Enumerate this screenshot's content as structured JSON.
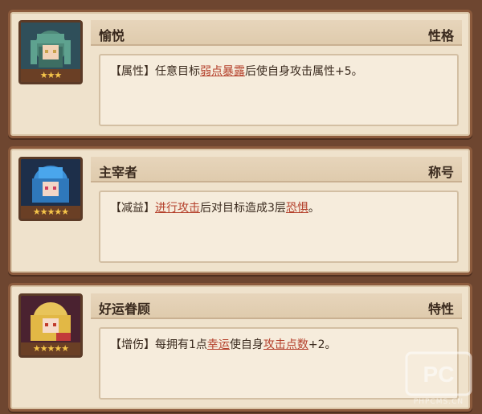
{
  "cards": [
    {
      "name": "愉悦",
      "tag": "性格",
      "stars": "★★★",
      "desc_prefix": "【属性】任意目标",
      "kw1": "弱点暴露",
      "desc_mid": "后使自身攻击属性+5。",
      "kw2": "",
      "desc_suffix": ""
    },
    {
      "name": "主宰者",
      "tag": "称号",
      "stars": "★★★★★",
      "desc_prefix": "【减益】",
      "kw1": "进行攻击",
      "desc_mid": "后对目标造成3层",
      "kw2": "恐惧",
      "desc_suffix": "。"
    },
    {
      "name": "好运眷顾",
      "tag": "特性",
      "stars": "★★★★★",
      "desc_prefix": "【增伤】每拥有1点",
      "kw1": "幸运",
      "desc_mid": "使自身",
      "kw2": "攻击点数",
      "desc_suffix": "+2。"
    }
  ],
  "watermark": {
    "logo": "PC",
    "text": "PHPCMS.CN"
  },
  "colors": {
    "background": "#6e4630",
    "card": "#efe2cc",
    "keyword": "#b4402b",
    "star": "#f5c54a"
  }
}
